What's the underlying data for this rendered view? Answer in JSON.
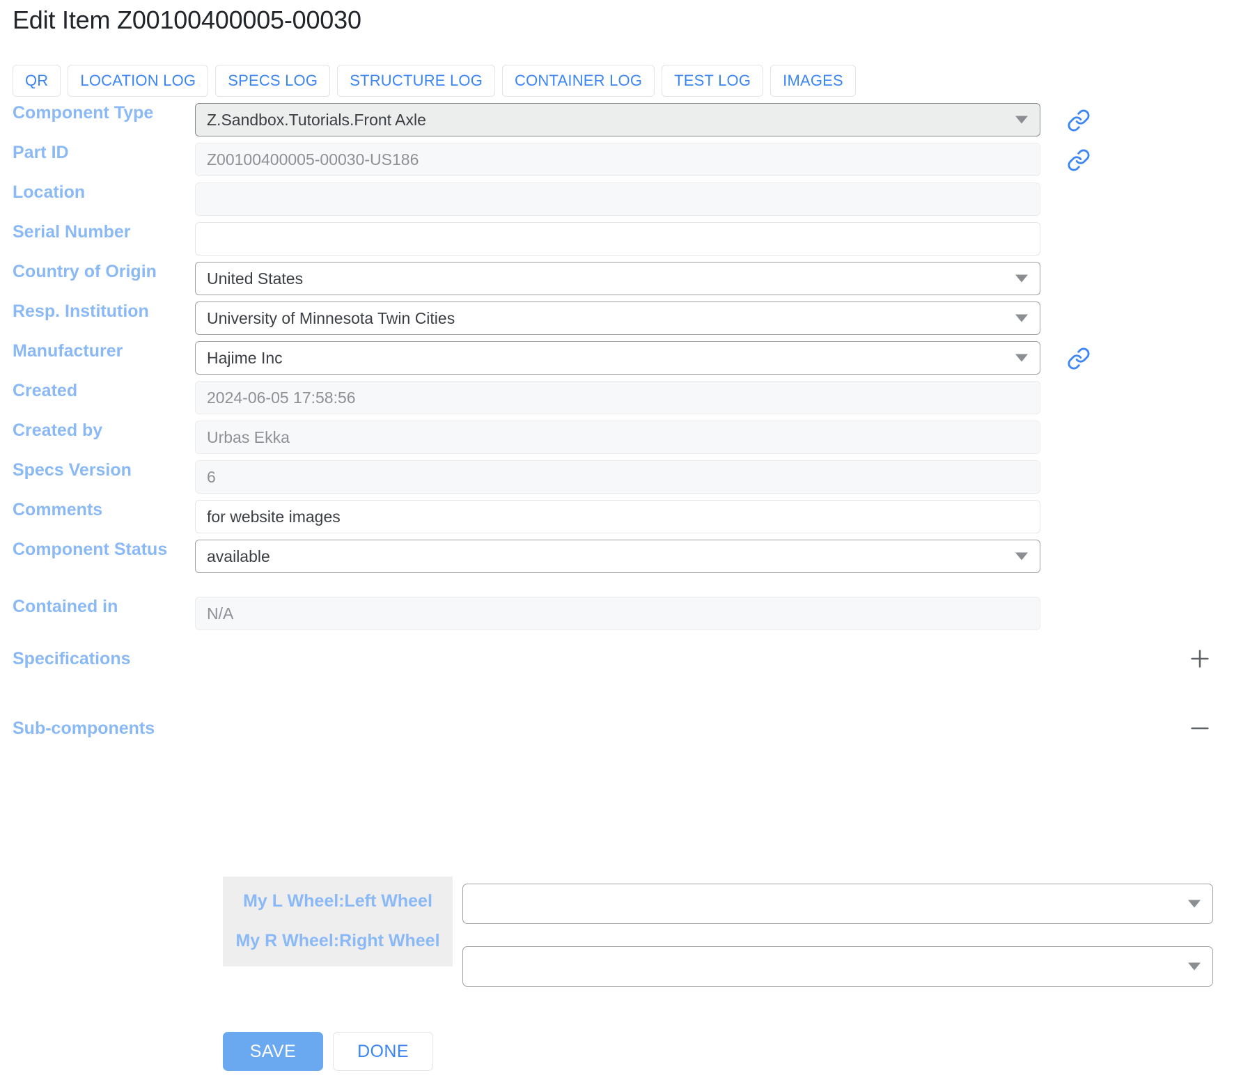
{
  "header": {
    "title": "Edit Item Z00100400005-00030"
  },
  "tabs": [
    {
      "label": "QR",
      "name": "qr"
    },
    {
      "label": "LOCATION LOG",
      "name": "location-log"
    },
    {
      "label": "SPECS LOG",
      "name": "specs-log"
    },
    {
      "label": "STRUCTURE LOG",
      "name": "structure-log"
    },
    {
      "label": "CONTAINER LOG",
      "name": "container-log"
    },
    {
      "label": "TEST LOG",
      "name": "test-log"
    },
    {
      "label": "IMAGES",
      "name": "images"
    }
  ],
  "fields": {
    "component_type": {
      "label": "Component Type",
      "value": "Z.Sandbox.Tutorials.Front Axle",
      "link_icon": "link-icon"
    },
    "part_id": {
      "label": "Part ID",
      "value": "Z00100400005-00030-US186",
      "link_icon": "link-icon"
    },
    "location": {
      "label": "Location",
      "value": ""
    },
    "serial_number": {
      "label": "Serial Number",
      "value": ""
    },
    "country_of_origin": {
      "label": "Country of Origin",
      "value": "United States"
    },
    "resp_institution": {
      "label": "Resp. Institution",
      "value": "University of Minnesota Twin Cities"
    },
    "manufacturer": {
      "label": "Manufacturer",
      "value": "Hajime Inc",
      "link_icon": "link-icon"
    },
    "created": {
      "label": "Created",
      "value": "2024-06-05 17:58:56"
    },
    "created_by": {
      "label": "Created by",
      "value": "Urbas Ekka"
    },
    "specs_version": {
      "label": "Specs Version",
      "value": "6"
    },
    "comments": {
      "label": "Comments",
      "value": "for website images"
    },
    "component_status": {
      "label": "Component Status",
      "value": "available"
    },
    "contained_in": {
      "label": "Contained in",
      "value": "N/A"
    }
  },
  "sections": {
    "specifications": {
      "label": "Specifications",
      "toggle": "+"
    },
    "subcomponents": {
      "label": "Sub-components",
      "toggle": "—"
    }
  },
  "subcomponents": {
    "rows": [
      {
        "name": "My L Wheel:Left Wheel",
        "value": ""
      },
      {
        "name": "My R Wheel:Right Wheel",
        "value": ""
      }
    ]
  },
  "footer": {
    "save_label": "SAVE",
    "done_label": "DONE"
  },
  "colors": {
    "label_blue": "#8bb9f5",
    "link_blue": "#3b86f3",
    "primary_button": "#6aa8f0",
    "title_text": "#212529"
  }
}
